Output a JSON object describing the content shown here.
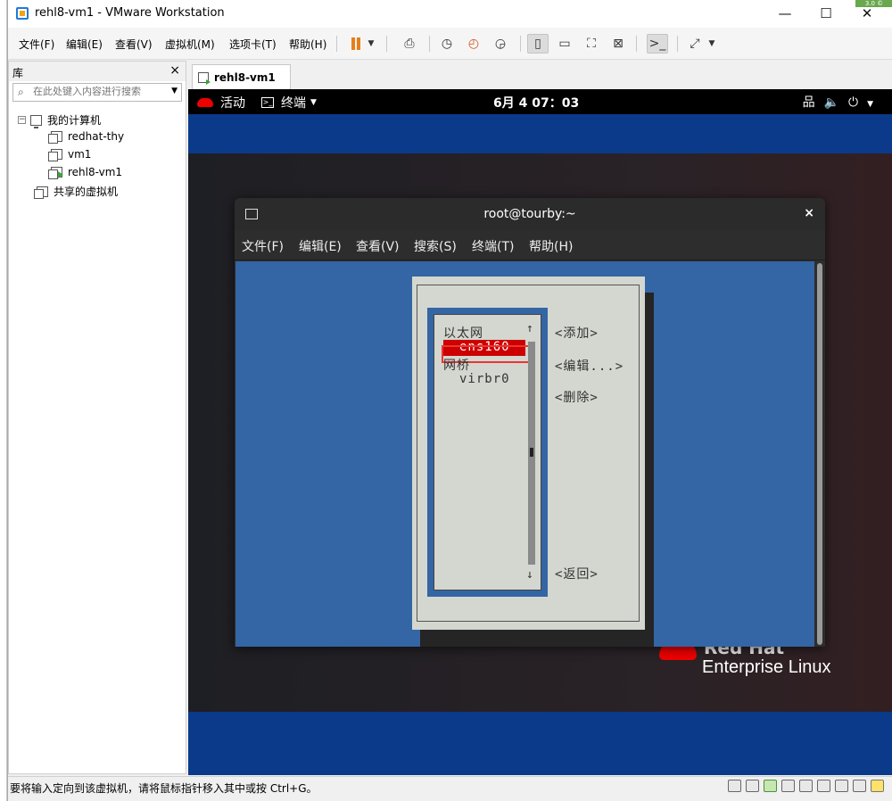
{
  "window": {
    "title": "rehl8-vm1 - VMware Workstation",
    "minimize": "—",
    "maximize": "☐",
    "close": "✕",
    "notification": "3.0 ©"
  },
  "menubar": {
    "items": [
      "文件(F)",
      "编辑(E)",
      "查看(V)",
      "虚拟机(M)",
      "选项卡(T)",
      "帮助(H)"
    ]
  },
  "library": {
    "title": "库",
    "close": "×",
    "search_placeholder": "在此处键入内容进行搜索",
    "root": "我的计算机",
    "vms": [
      "redhat-thy",
      "vm1",
      "rehl8-vm1"
    ],
    "shared": "共享的虚拟机"
  },
  "tab": {
    "label": "rehl8-vm1"
  },
  "gnome": {
    "activities": "活动",
    "app_menu": "终端",
    "clock": "6月 4 07：03"
  },
  "terminal": {
    "title": "root@tourby:~",
    "close": "×",
    "menu": [
      "文件(F)",
      "编辑(E)",
      "查看(V)",
      "搜索(S)",
      "终端(T)",
      "帮助(H)"
    ]
  },
  "nmtui": {
    "items": [
      {
        "text": "以太网",
        "selected": false
      },
      {
        "text": "ens160",
        "selected": true
      },
      {
        "text": "网桥",
        "selected": false
      },
      {
        "text": "virbr0",
        "selected": false
      }
    ],
    "buttons": [
      "<添加>",
      "<编辑...>",
      "<删除>",
      "<返回>"
    ],
    "arrow_up": "↑",
    "arrow_down": "↓"
  },
  "desktop": {
    "brand_line1": "Red Hat",
    "brand_line2": "Enterprise Linux"
  },
  "statusbar": {
    "message": "要将输入定向到该虚拟机，请将鼠标指针移入其中或按 Ctrl+G。"
  },
  "colors": {
    "vm_blue": "#0b3a8a",
    "terminal_bg": "#3465a4",
    "nmtui_gray": "#d3d7cf",
    "selection_red": "#cc0000",
    "accent_orange": "#e87e1a"
  }
}
